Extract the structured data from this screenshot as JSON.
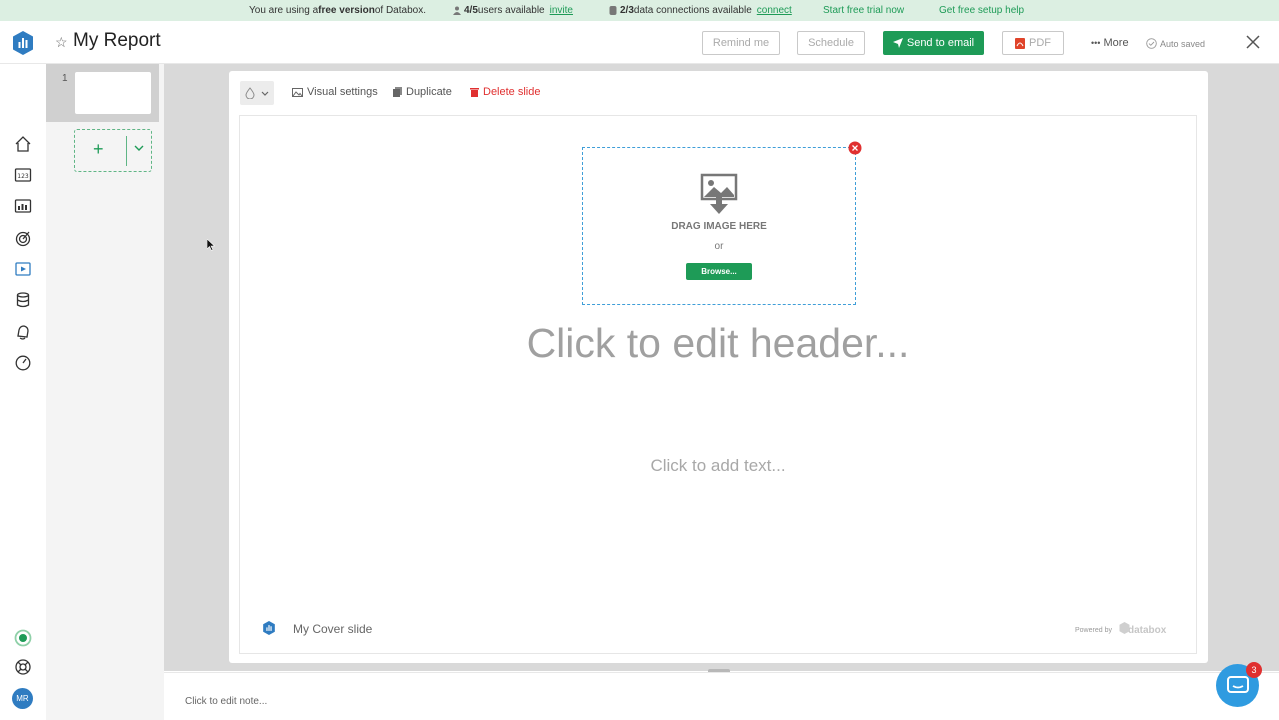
{
  "banner": {
    "free_pre": "You are using a ",
    "free_bold": "free version",
    "free_post": " of Databox.",
    "users_count": "4/5",
    "users_text": " users available",
    "invite": "invite",
    "conn_count": "2/3",
    "conn_text": " data connections available",
    "connect": "connect",
    "trial": "Start free trial now",
    "setup_help": "Get free setup help"
  },
  "header": {
    "title": "My Report",
    "remind": "Remind me",
    "schedule": "Schedule",
    "send": "Send to email",
    "pdf": "PDF",
    "more": "More",
    "autosaved": "Auto saved"
  },
  "thumbs": {
    "slide_number": "1"
  },
  "toolbar": {
    "visual_settings": "Visual settings",
    "duplicate": "Duplicate",
    "delete": "Delete slide"
  },
  "slide": {
    "drop_text": "DRAG IMAGE HERE",
    "or": "or",
    "browse": "Browse...",
    "header": "Click to edit header...",
    "text": "Click to add text...",
    "footer_name": "My Cover slide",
    "powered_by": "Powered by",
    "brand": "databox"
  },
  "note": {
    "placeholder": "Click to edit note..."
  },
  "user": {
    "initials": "MR"
  },
  "chat": {
    "badge": "3"
  },
  "colors": {
    "brand_green": "#1e9b57",
    "brand_blue": "#2f7cc1",
    "danger": "#e03030"
  }
}
